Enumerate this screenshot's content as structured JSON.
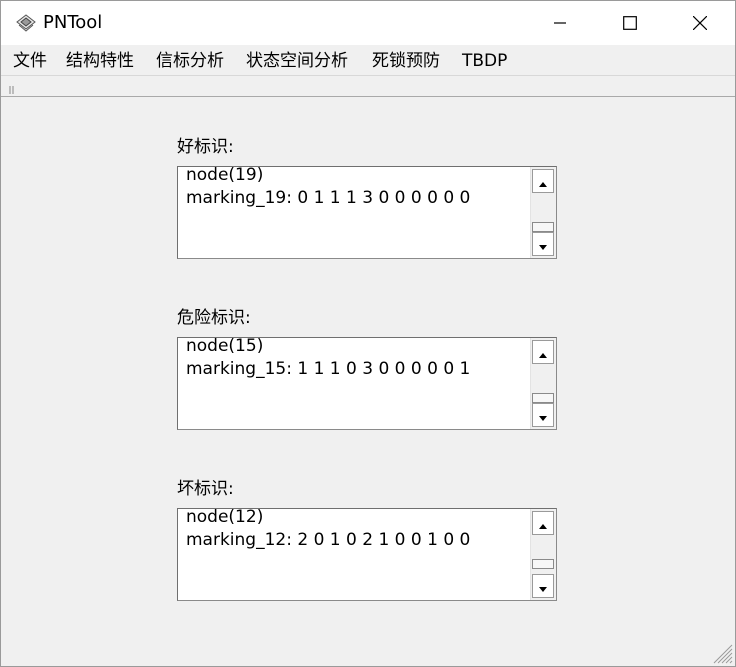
{
  "window": {
    "title": "PNTool"
  },
  "menu": {
    "items": [
      "文件",
      "结构特性",
      "信标分析",
      "状态空间分析",
      "死锁预防",
      "TBDP"
    ]
  },
  "sections": [
    {
      "label": "好标识:",
      "line1": "node(19)",
      "line2": "marking_19: 0 1 1 1 3 0 0 0 0 0 0"
    },
    {
      "label": "危险标识:",
      "line1": "node(15)",
      "line2": "marking_15: 1 1 1 0 3 0 0 0 0 0 1"
    },
    {
      "label": "坏标识:",
      "line1": "node(12)",
      "line2": "marking_12: 2 0 1 0 2 1 0 0 1 0 0"
    }
  ],
  "icons": {
    "app": "pntool-app-icon",
    "minimize": "minimize-icon",
    "maximize": "maximize-icon",
    "close": "close-icon",
    "scroll_up": "scroll-up-icon",
    "scroll_down": "scroll-down-icon",
    "toolbar_grip": "toolbar-grip-icon",
    "resize": "resize-grip-icon"
  }
}
